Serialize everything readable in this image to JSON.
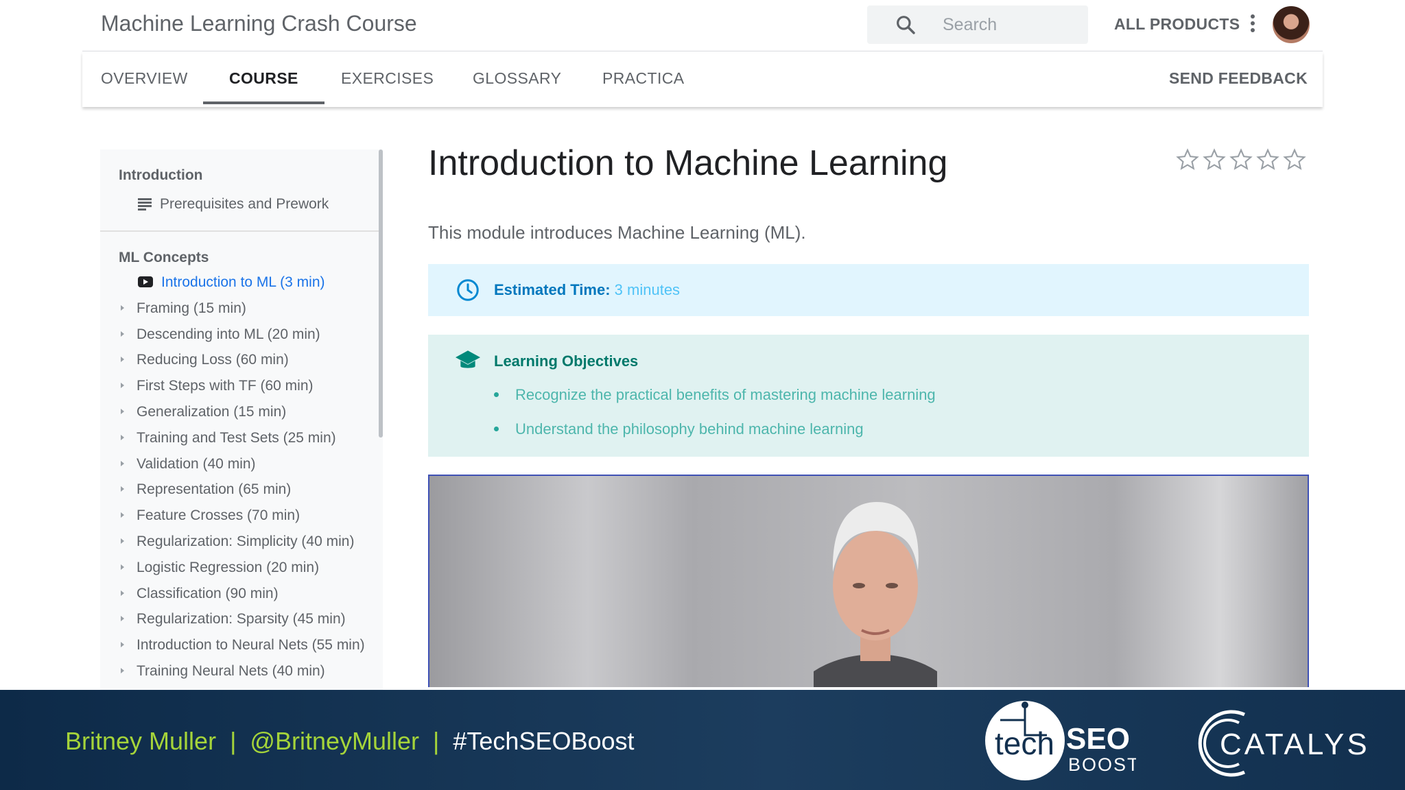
{
  "header": {
    "app_title": "Machine Learning Crash Course",
    "search_placeholder": "Search",
    "all_products": "ALL PRODUCTS"
  },
  "tabs": [
    {
      "label": "OVERVIEW"
    },
    {
      "label": "COURSE"
    },
    {
      "label": "EXERCISES"
    },
    {
      "label": "GLOSSARY"
    },
    {
      "label": "PRACTICA"
    }
  ],
  "active_tab": "COURSE",
  "send_feedback": "SEND FEEDBACK",
  "sidebar": {
    "intro_heading": "Introduction",
    "intro_item": "Prerequisites and Prework",
    "concepts_heading": "ML Concepts",
    "active_item": "Introduction to ML (3 min)",
    "items": [
      {
        "label": "Framing (15 min)"
      },
      {
        "label": "Descending into ML (20 min)"
      },
      {
        "label": "Reducing Loss (60 min)"
      },
      {
        "label": "First Steps with TF (60 min)"
      },
      {
        "label": "Generalization (15 min)"
      },
      {
        "label": "Training and Test Sets (25 min)"
      },
      {
        "label": "Validation (40 min)"
      },
      {
        "label": "Representation (65 min)"
      },
      {
        "label": "Feature Crosses (70 min)"
      },
      {
        "label": "Regularization: Simplicity (40 min)"
      },
      {
        "label": "Logistic Regression (20 min)"
      },
      {
        "label": "Classification (90 min)"
      },
      {
        "label": "Regularization: Sparsity (45 min)"
      },
      {
        "label": "Introduction to Neural Nets (55 min)"
      },
      {
        "label": "Training Neural Nets (40 min)"
      }
    ]
  },
  "main": {
    "title": "Introduction to Machine Learning",
    "intro": "This module introduces Machine Learning (ML).",
    "estimated_label": "Estimated Time:",
    "estimated_value": "3 minutes",
    "objectives_title": "Learning Objectives",
    "objectives": [
      "Recognize the practical benefits of mastering machine learning",
      "Understand the philosophy behind machine learning"
    ],
    "rating": {
      "filled": 0,
      "max": 5
    }
  },
  "footer": {
    "name": "Britney Muller",
    "handle": "@BritneyMuller",
    "hashtag": "#TechSEOBoost",
    "logo_techseo": {
      "tech": "tech",
      "seo": "SEO",
      "boost": "BOOST"
    },
    "logo_catalyst": "CATALYST"
  },
  "colors": {
    "accent_blue": "#1a73e8",
    "info_bg": "#e1f5fe",
    "objectives_bg": "#e0f2f1",
    "footer_green": "#a5d43a",
    "footer_bg": "#12304f"
  }
}
